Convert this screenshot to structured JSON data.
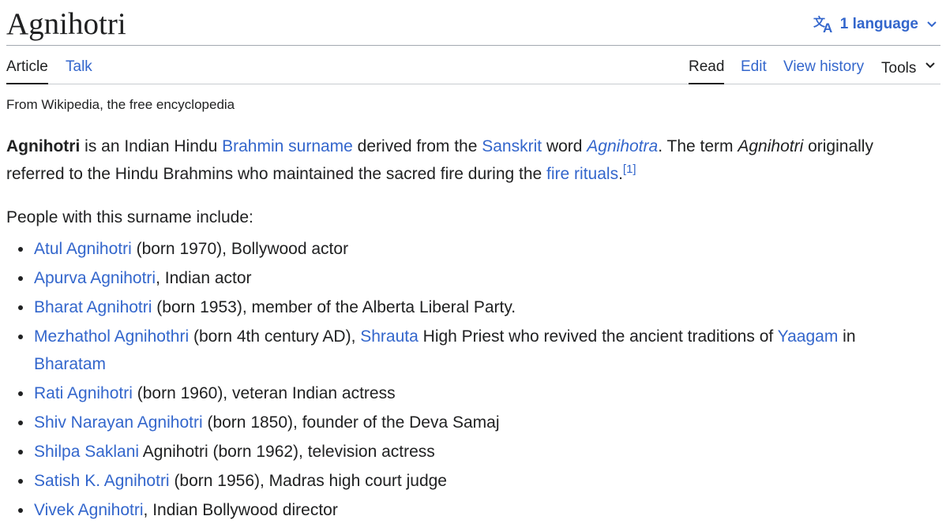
{
  "header": {
    "title": "Agnihotri",
    "language_button": "1 language"
  },
  "tabs": {
    "article": "Article",
    "talk": "Talk",
    "read": "Read",
    "edit": "Edit",
    "view_history": "View history",
    "tools": "Tools"
  },
  "tagline": "From Wikipedia, the free encyclopedia",
  "intro": {
    "bold": "Agnihotri",
    "t1": " is an Indian Hindu ",
    "link_brahmin_surname": "Brahmin surname",
    "t2": " derived from the ",
    "link_sanskrit": "Sanskrit",
    "t3": " word ",
    "link_agnihotra": "Agnihotra",
    "t4": ". The term ",
    "italic_term": "Agnihotri",
    "t5": " originally referred to the Hindu Brahmins who maintained the sacred fire during the ",
    "link_fire_rituals": "fire rituals",
    "t6": ".",
    "ref": "[1]"
  },
  "people_intro": "People with this surname include:",
  "people": [
    {
      "link": "Atul Agnihotri",
      "text": " (born 1970), Bollywood actor"
    },
    {
      "link": "Apurva Agnihotri",
      "text": ", Indian actor"
    },
    {
      "link": "Bharat Agnihotri",
      "text": " (born 1953), member of the Alberta Liberal Party."
    },
    {
      "link": "Mezhathol Agnihothri",
      "text": " (born 4th century AD), ",
      "link2": "Shrauta",
      "text2": " High Priest who revived the ancient traditions of ",
      "link3": "Yaagam",
      "text3": " in ",
      "link4": "Bharatam"
    },
    {
      "link": "Rati Agnihotri",
      "text": " (born 1960), veteran Indian actress"
    },
    {
      "link": "Shiv Narayan Agnihotri",
      "text": " (born 1850), founder of the Deva Samaj"
    },
    {
      "link": "Shilpa Saklani",
      "text": " Agnihotri (born 1962), television actress"
    },
    {
      "link": "Satish K. Agnihotri",
      "text": " (born 1956), Madras high court judge"
    },
    {
      "link": "Vivek Agnihotri",
      "text": ", Indian Bollywood director"
    }
  ],
  "colors": {
    "link": "#3366cc",
    "text": "#202122",
    "divider": "#a2a9b1"
  },
  "icons": {
    "language": "translate-icon",
    "language_chevron": "chevron-down-icon",
    "tools_chevron": "chevron-down-icon"
  }
}
